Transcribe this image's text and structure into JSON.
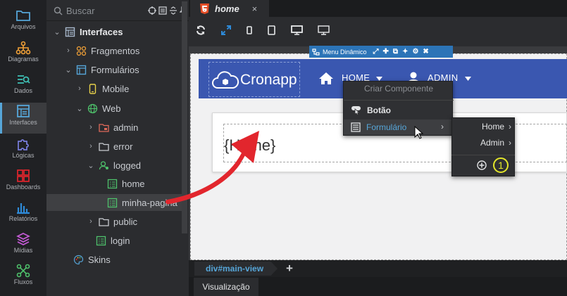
{
  "activity": [
    {
      "label": "Arquivos",
      "icon": "folder-icon"
    },
    {
      "label": "Diagramas",
      "icon": "diagram-icon"
    },
    {
      "label": "Dados",
      "icon": "data-icon"
    },
    {
      "label": "Interfaces",
      "icon": "interfaces-icon",
      "selected": true
    },
    {
      "label": "Lógicas",
      "icon": "logic-puzzle-icon"
    },
    {
      "label": "Dashboards",
      "icon": "dashboard-icon"
    },
    {
      "label": "Relatórios",
      "icon": "reports-icon"
    },
    {
      "label": "Mídias",
      "icon": "media-layers-icon"
    },
    {
      "label": "Fluxos",
      "icon": "flows-icon"
    }
  ],
  "search": {
    "placeholder": "Buscar"
  },
  "tree": [
    {
      "label": "Interfaces",
      "level": 0,
      "chevron": "down",
      "icon": "interfaces-icon",
      "bold": true
    },
    {
      "label": "Fragmentos",
      "level": 1,
      "chevron": "right",
      "icon": "fragments-icon"
    },
    {
      "label": "Formulários",
      "level": 1,
      "chevron": "down",
      "icon": "forms-icon"
    },
    {
      "label": "Mobile",
      "level": 2,
      "chevron": "right",
      "icon": "mobile-icon"
    },
    {
      "label": "Web",
      "level": 2,
      "chevron": "down",
      "icon": "globe-icon"
    },
    {
      "label": "admin",
      "level": 3,
      "chevron": "right",
      "icon": "folder-lock-icon"
    },
    {
      "label": "error",
      "level": 3,
      "chevron": "right",
      "icon": "folder-icon"
    },
    {
      "label": "logged",
      "level": 3,
      "chevron": "down",
      "icon": "folder-user-icon"
    },
    {
      "label": "home",
      "level": 4,
      "chevron": "",
      "icon": "form-file-icon"
    },
    {
      "label": "minha-pagina",
      "level": 4,
      "chevron": "",
      "icon": "form-file-icon",
      "selected": true
    },
    {
      "label": "public",
      "level": 3,
      "chevron": "right",
      "icon": "folder-icon"
    },
    {
      "label": "login",
      "level": 3,
      "chevron": "",
      "icon": "form-file-icon"
    },
    {
      "label": "Skins",
      "level": 1,
      "chevron": "",
      "icon": "palette-icon"
    }
  ],
  "editor": {
    "tab": {
      "label": "home",
      "close": "×"
    },
    "page": {
      "brand": "Cronapp",
      "nav_home": "HOME",
      "nav_admin": "ADMIN",
      "heading": "{Home}"
    },
    "component_toolbar": {
      "label": "Menu Dinâmico"
    },
    "context_menu": {
      "header": "Criar Componente",
      "items": [
        {
          "label": "Botão",
          "icon": "button-hand-icon"
        },
        {
          "label": "Formulário",
          "icon": "form-icon",
          "highlighted": true
        }
      ]
    },
    "submenu": {
      "items": [
        {
          "label": "Home"
        },
        {
          "label": "Admin"
        }
      ],
      "badge": "1"
    },
    "breadcrumb": "div#main-view",
    "add": "+",
    "visualization": "Visualização"
  },
  "colors": {
    "accent": "#56a6d9",
    "navbar": "#3a57b0",
    "toolbar_blue": "#2c74b7",
    "arrow": "#e2262d",
    "badge": "#e3e62a"
  }
}
